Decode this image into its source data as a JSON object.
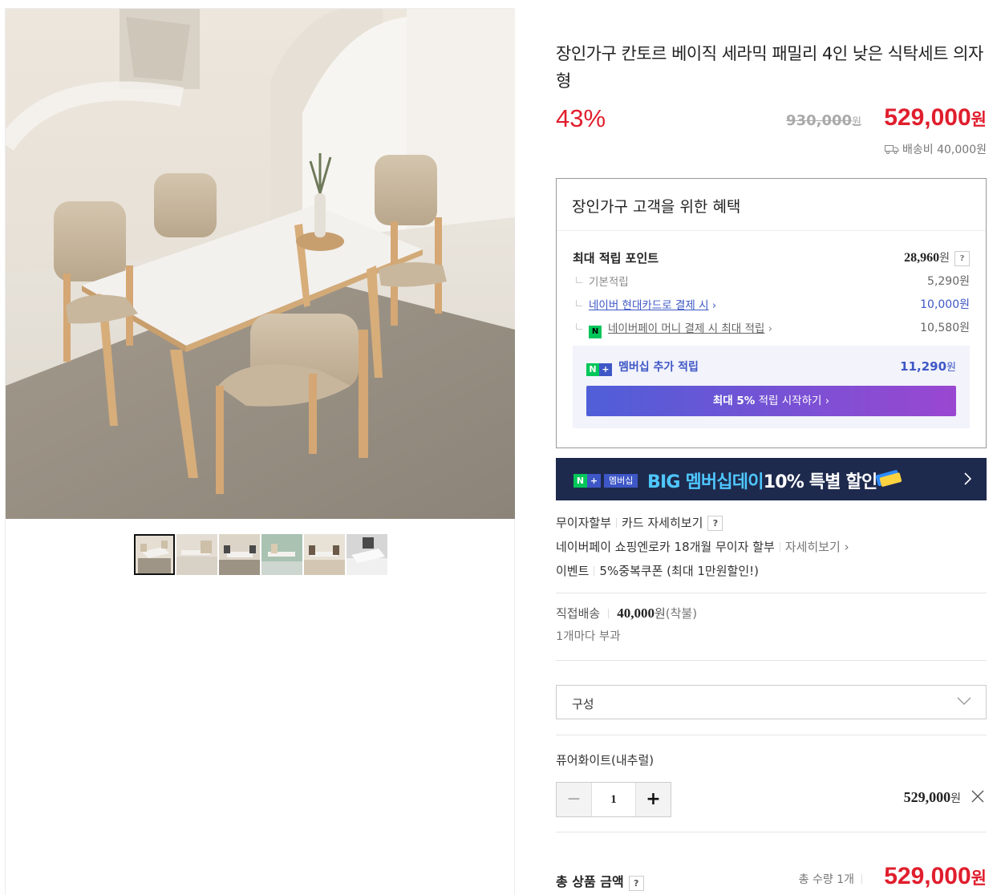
{
  "product": {
    "title": "장인가구 칸토르 베이직 세라믹 패밀리 4인 낮은 식탁세트 의자형",
    "discount": "43%",
    "original_price": "930,000",
    "original_price_unit": "원",
    "sale_price": "529,000",
    "sale_price_unit": "원",
    "shipping_fee": "배송비 40,000원"
  },
  "gallery": {
    "main_image": "dining-table-set-photo",
    "thumbnails": [
      "thumb-1",
      "thumb-2",
      "thumb-3",
      "thumb-4",
      "thumb-5",
      "thumb-6"
    ],
    "active_index": 0
  },
  "benefits": {
    "heading": "장인가구 고객을 위한 혜택",
    "max_points_label": "최대 적립 포인트",
    "max_points_value": "28,960",
    "won": "원",
    "help": "?",
    "rows": [
      {
        "label": "기본적립",
        "value": "5,290원"
      },
      {
        "label": "네이버 현대카드로 결제 시",
        "value": "10,000원"
      },
      {
        "label": "네이버페이 머니 결제 시 최대 적립",
        "value": "10,580원"
      }
    ],
    "chevron": "›",
    "npay_icon": "N",
    "membership_label": "멤버십 추가 적립",
    "membership_value": "11,290",
    "membership_cta_bold": "최대 5%",
    "membership_cta_rest": "적립 시작하기",
    "nplus_n": "N",
    "nplus_plus": "+"
  },
  "banner": {
    "badge": "멤버십",
    "text_big": "BIG",
    "text_hl": "멤버십데이",
    "text_rest": "10% 특별 할인"
  },
  "payment_info": {
    "installment_label": "무이자할부",
    "card_detail": "카드 자세히보기",
    "npay_installment": "네이버페이 쇼핑엔로카 18개월 무이자 할부",
    "detail_link": "자세히보기",
    "event_label": "이벤트",
    "event_text": "5%중복쿠폰 (최대 1만원할인!)"
  },
  "delivery": {
    "type": "직접배송",
    "fee": "40,000",
    "fee_unit": "원",
    "fee_note": "(착불)",
    "note": "1개마다 부과"
  },
  "option_select": {
    "label": "구성"
  },
  "selected_option": {
    "name": "퓨어화이트(내추럴)",
    "minus": "−",
    "plus": "+",
    "quantity": "1",
    "price": "529,000",
    "price_unit": "원"
  },
  "total": {
    "label": "총 상품 금액",
    "qty_text": "총 수량 1개",
    "price": "529,000",
    "price_unit": "원"
  },
  "colors": {
    "accent_red": "#e01e2d",
    "link_blue": "#3e57c6",
    "banner_bg": "#1e2a4d"
  }
}
